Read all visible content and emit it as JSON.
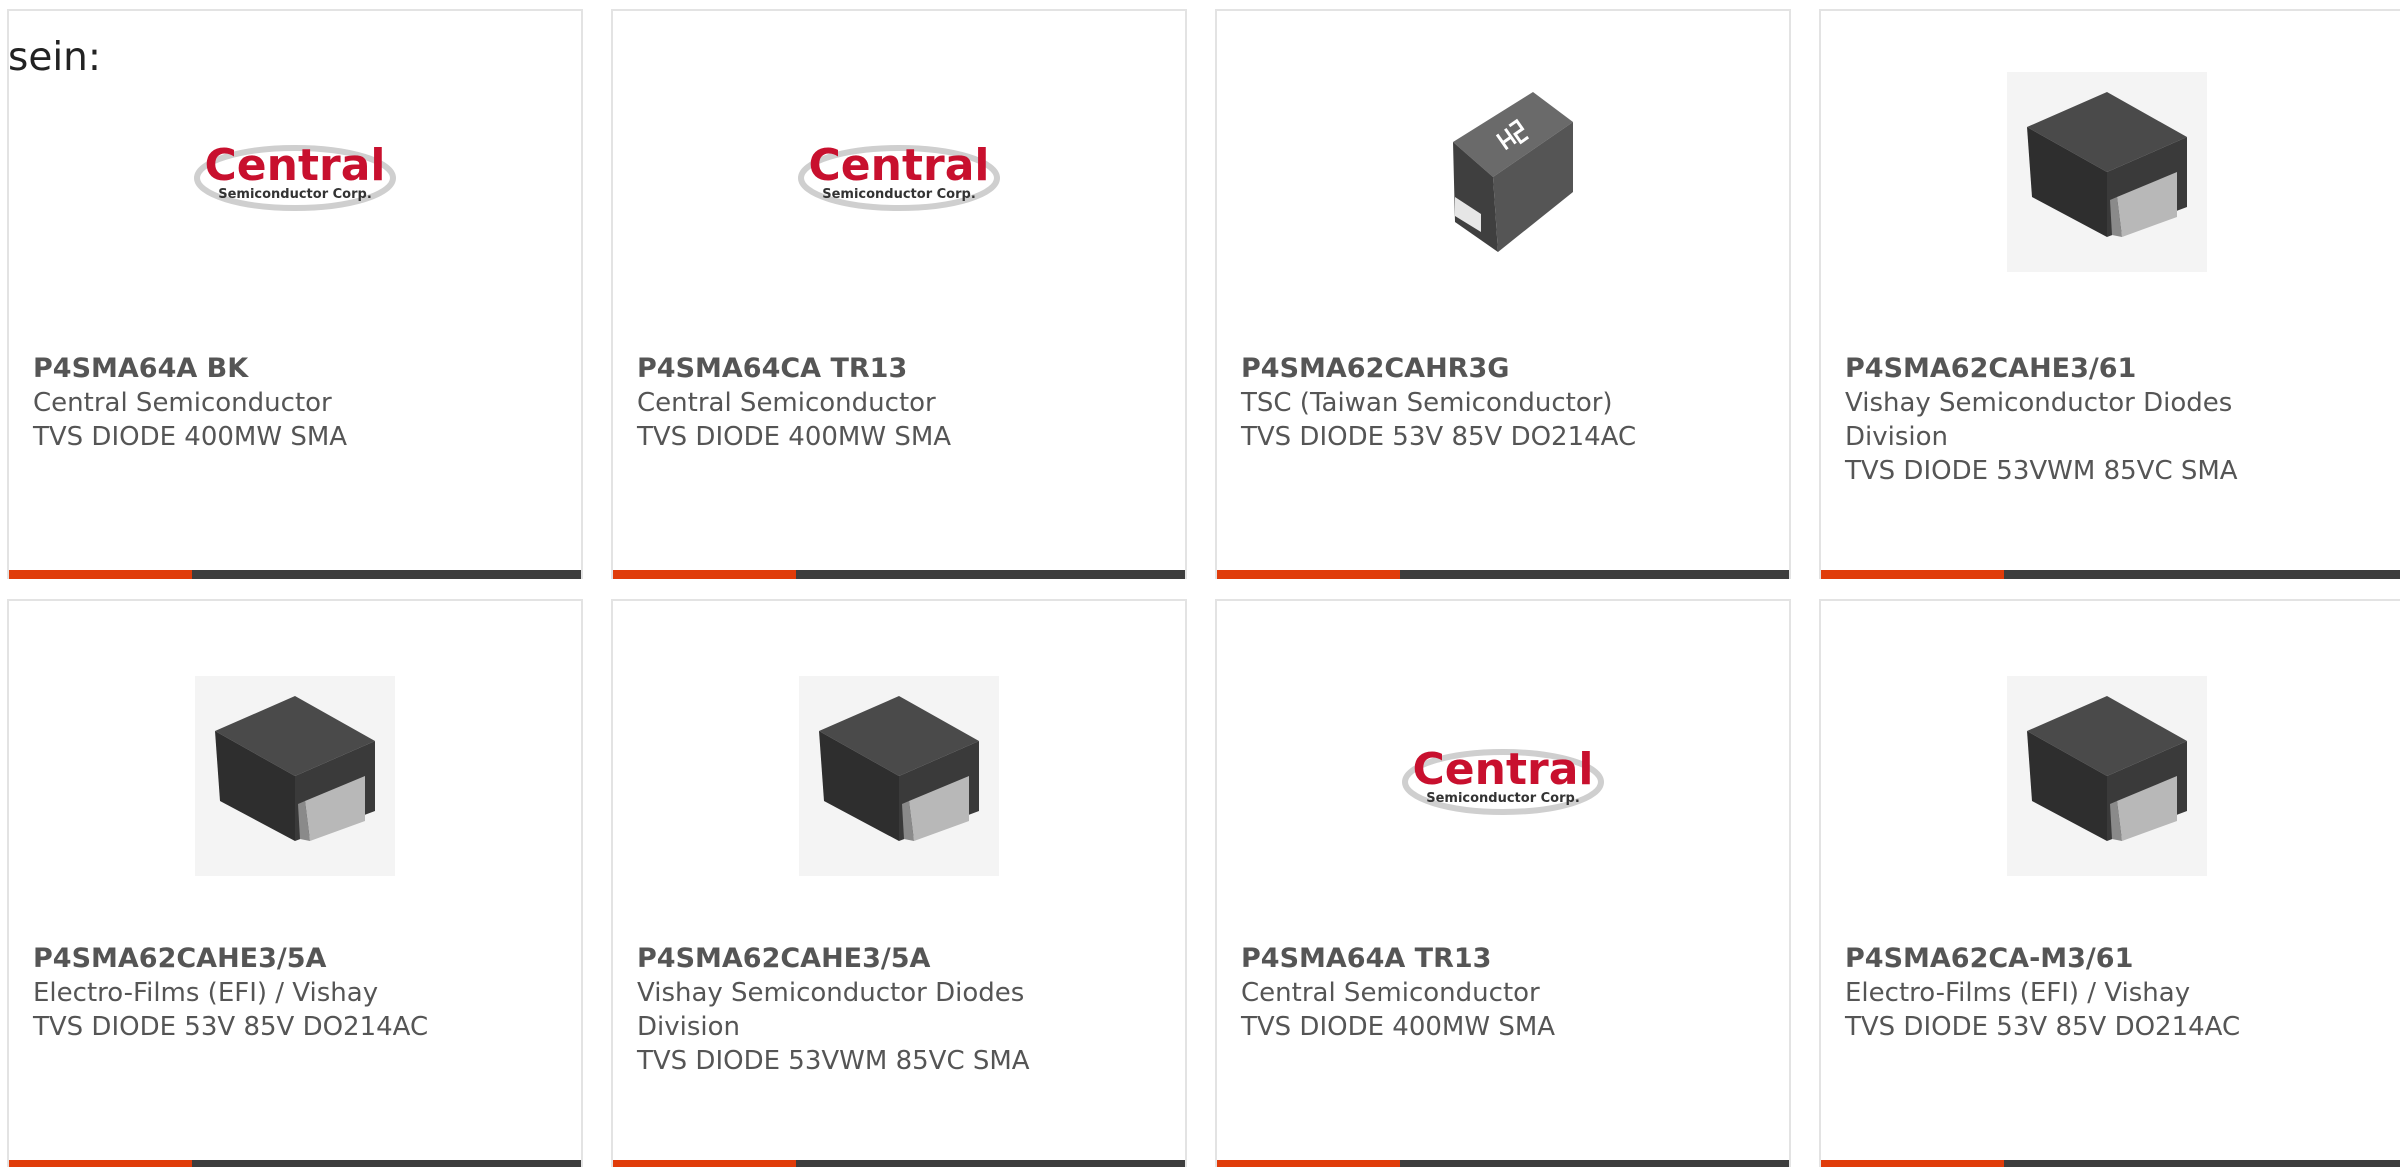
{
  "lead_text": "sein:",
  "colors": {
    "accent": "#e03c0a",
    "bar": "#3d3d3d",
    "text": "#555555",
    "logo_red": "#c8102e"
  },
  "logos": {
    "central_main": "Central",
    "central_sub": "Semiconductor Corp."
  },
  "cards": [
    {
      "part_number": "P4SMA64A BK",
      "manufacturer": "Central Semiconductor",
      "description": "TVS DIODE 400MW SMA",
      "image": "central-logo"
    },
    {
      "part_number": "P4SMA64CA TR13",
      "manufacturer": "Central Semiconductor",
      "description": "TVS DIODE 400MW SMA",
      "image": "central-logo"
    },
    {
      "part_number": "P4SMA62CAHR3G",
      "manufacturer": "TSC (Taiwan Semiconductor)",
      "description": "TVS DIODE 53V 85V DO214AC",
      "image": "tsc-diode-photo"
    },
    {
      "part_number": "P4SMA62CAHE3/61",
      "manufacturer": "Vishay Semiconductor Diodes Division",
      "description": "TVS DIODE 53VWM 85VC SMA",
      "image": "sma-diode-photo"
    },
    {
      "part_number": "P4SMA62CAHE3/5A",
      "manufacturer": "Electro-Films (EFI) / Vishay",
      "description": "TVS DIODE 53V 85V DO214AC",
      "image": "sma-diode-photo"
    },
    {
      "part_number": "P4SMA62CAHE3/5A",
      "manufacturer": "Vishay Semiconductor Diodes Division",
      "description": "TVS DIODE 53VWM 85VC SMA",
      "image": "sma-diode-photo"
    },
    {
      "part_number": "P4SMA64A TR13",
      "manufacturer": "Central Semiconductor",
      "description": "TVS DIODE 400MW SMA",
      "image": "central-logo"
    },
    {
      "part_number": "P4SMA62CA-M3/61",
      "manufacturer": "Electro-Films (EFI) / Vishay",
      "description": "TVS DIODE 53V 85V DO214AC",
      "image": "sma-diode-photo"
    }
  ]
}
